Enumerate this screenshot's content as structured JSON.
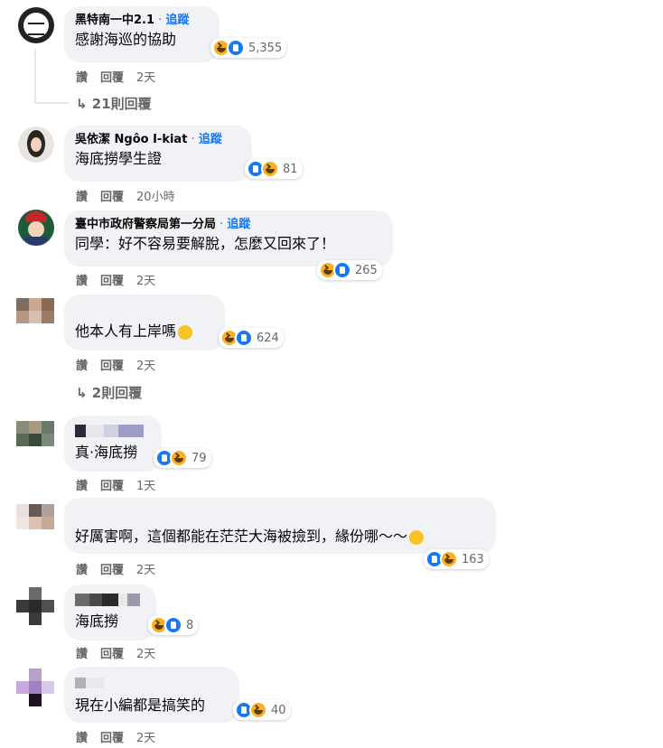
{
  "comments": [
    {
      "author": "黑特南一中2.1",
      "follow": "追蹤",
      "text": "感謝海巡的協助",
      "reaction_count": "5,355",
      "like": "讚",
      "reply": "回覆",
      "time": "2天",
      "more_replies": "21則回覆"
    },
    {
      "author": "吳依潔 Ngôo I-kiat",
      "follow": "追蹤",
      "text": "海底撈學生證",
      "reaction_count": "81",
      "like": "讚",
      "reply": "回覆",
      "time": "20小時"
    },
    {
      "author": "臺中市政府警察局第一分局",
      "follow": "追蹤",
      "text": "同學：好不容易要解脫，怎麼又回來了！",
      "reaction_count": "265",
      "like": "讚",
      "reply": "回覆",
      "time": "2天"
    },
    {
      "author": "",
      "text": "他本人有上岸嗎",
      "reaction_count": "624",
      "like": "讚",
      "reply": "回覆",
      "time": "2天",
      "more_replies": "2則回覆"
    },
    {
      "author": "",
      "text": "真·海底撈",
      "reaction_count": "79",
      "like": "讚",
      "reply": "回覆",
      "time": "1天"
    },
    {
      "author": "",
      "text": "好厲害啊，這個都能在茫茫大海被撿到，緣份哪～～",
      "reaction_count": "163",
      "like": "讚",
      "reply": "回覆",
      "time": "2天"
    },
    {
      "author": "",
      "text": "海底撈",
      "reaction_count": "8",
      "like": "讚",
      "reply": "回覆",
      "time": "2天"
    },
    {
      "author": "",
      "text": "現在小編都是搞笑的",
      "reaction_count": "40",
      "like": "讚",
      "reply": "回覆",
      "time": "2天"
    }
  ],
  "colors": {
    "bubble": "#f0f2f5",
    "link_blue": "#1877f2",
    "secondary_text": "#65676b",
    "like_blue": "#1877f2",
    "haha_yellow": "#f7b125"
  },
  "icons": {
    "reply_arrow": "reply-arrow-icon",
    "like_reaction": "like-reaction-icon",
    "haha_reaction": "haha-reaction-icon"
  }
}
